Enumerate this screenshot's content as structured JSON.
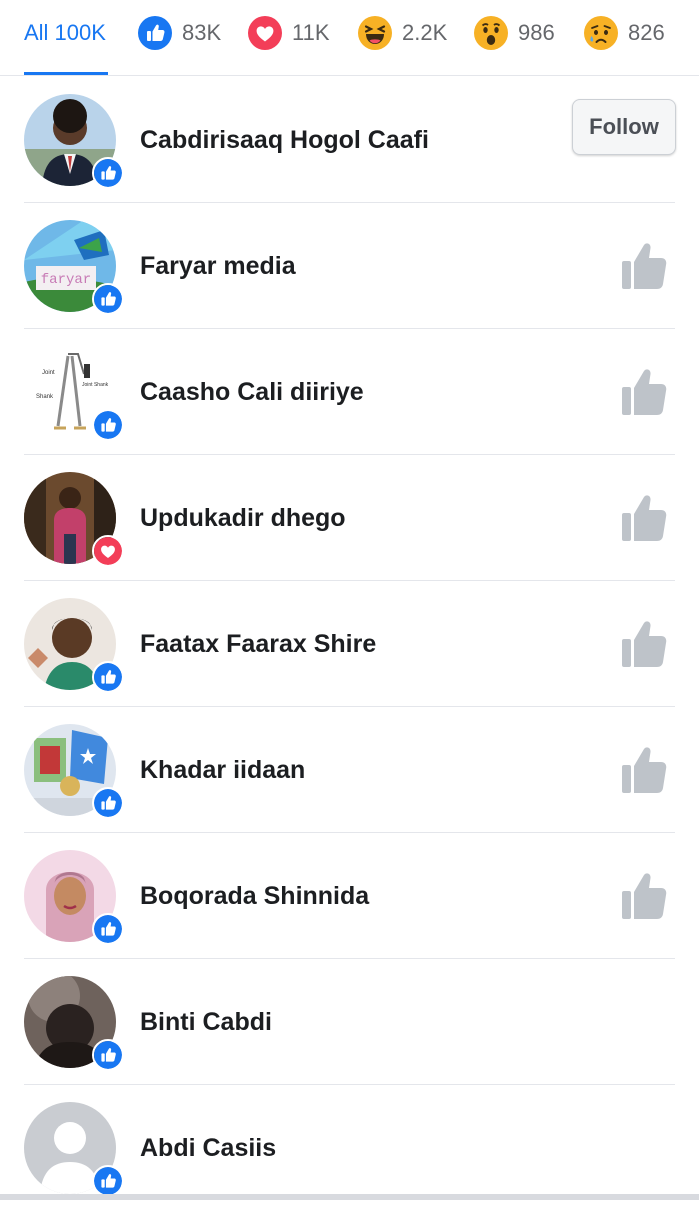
{
  "reactions_tabs": [
    {
      "label": "All 100K",
      "icon": null,
      "active": true
    },
    {
      "label": "83K",
      "icon": "like-icon"
    },
    {
      "label": "11K",
      "icon": "love-icon"
    },
    {
      "label": "2.2K",
      "icon": "haha-icon"
    },
    {
      "label": "986",
      "icon": "wow-icon"
    },
    {
      "label": "826",
      "icon": "sad-icon"
    }
  ],
  "colors": {
    "accent": "#1877f2",
    "love": "#f33e58",
    "reaction_yellow": "#f7b125",
    "divider": "#e4e6eb",
    "like_button_gray": "#bec3c9"
  },
  "people": [
    {
      "name": "Cabdirisaaq Hogol Caafi",
      "reaction": "like-icon",
      "action": "follow",
      "action_label": "Follow"
    },
    {
      "name": "Faryar media",
      "reaction": "like-icon",
      "action": "like",
      "avatar_text": "faryar"
    },
    {
      "name": "Caasho Cali diiriye",
      "reaction": "like-icon",
      "action": "like",
      "avatar_labels": [
        "Joint",
        "Joint Shank",
        "Shank"
      ]
    },
    {
      "name": "Updukadir dhego",
      "reaction": "love-icon",
      "action": "like"
    },
    {
      "name": "Faatax Faarax Shire",
      "reaction": "like-icon",
      "action": "like"
    },
    {
      "name": "Khadar iidaan",
      "reaction": "like-icon",
      "action": "like"
    },
    {
      "name": "Boqorada Shinnida",
      "reaction": "like-icon",
      "action": "like"
    },
    {
      "name": "Binti Cabdi",
      "reaction": "like-icon",
      "action": "none"
    },
    {
      "name": "Abdi Casiis",
      "reaction": "like-icon",
      "action": "none"
    }
  ]
}
